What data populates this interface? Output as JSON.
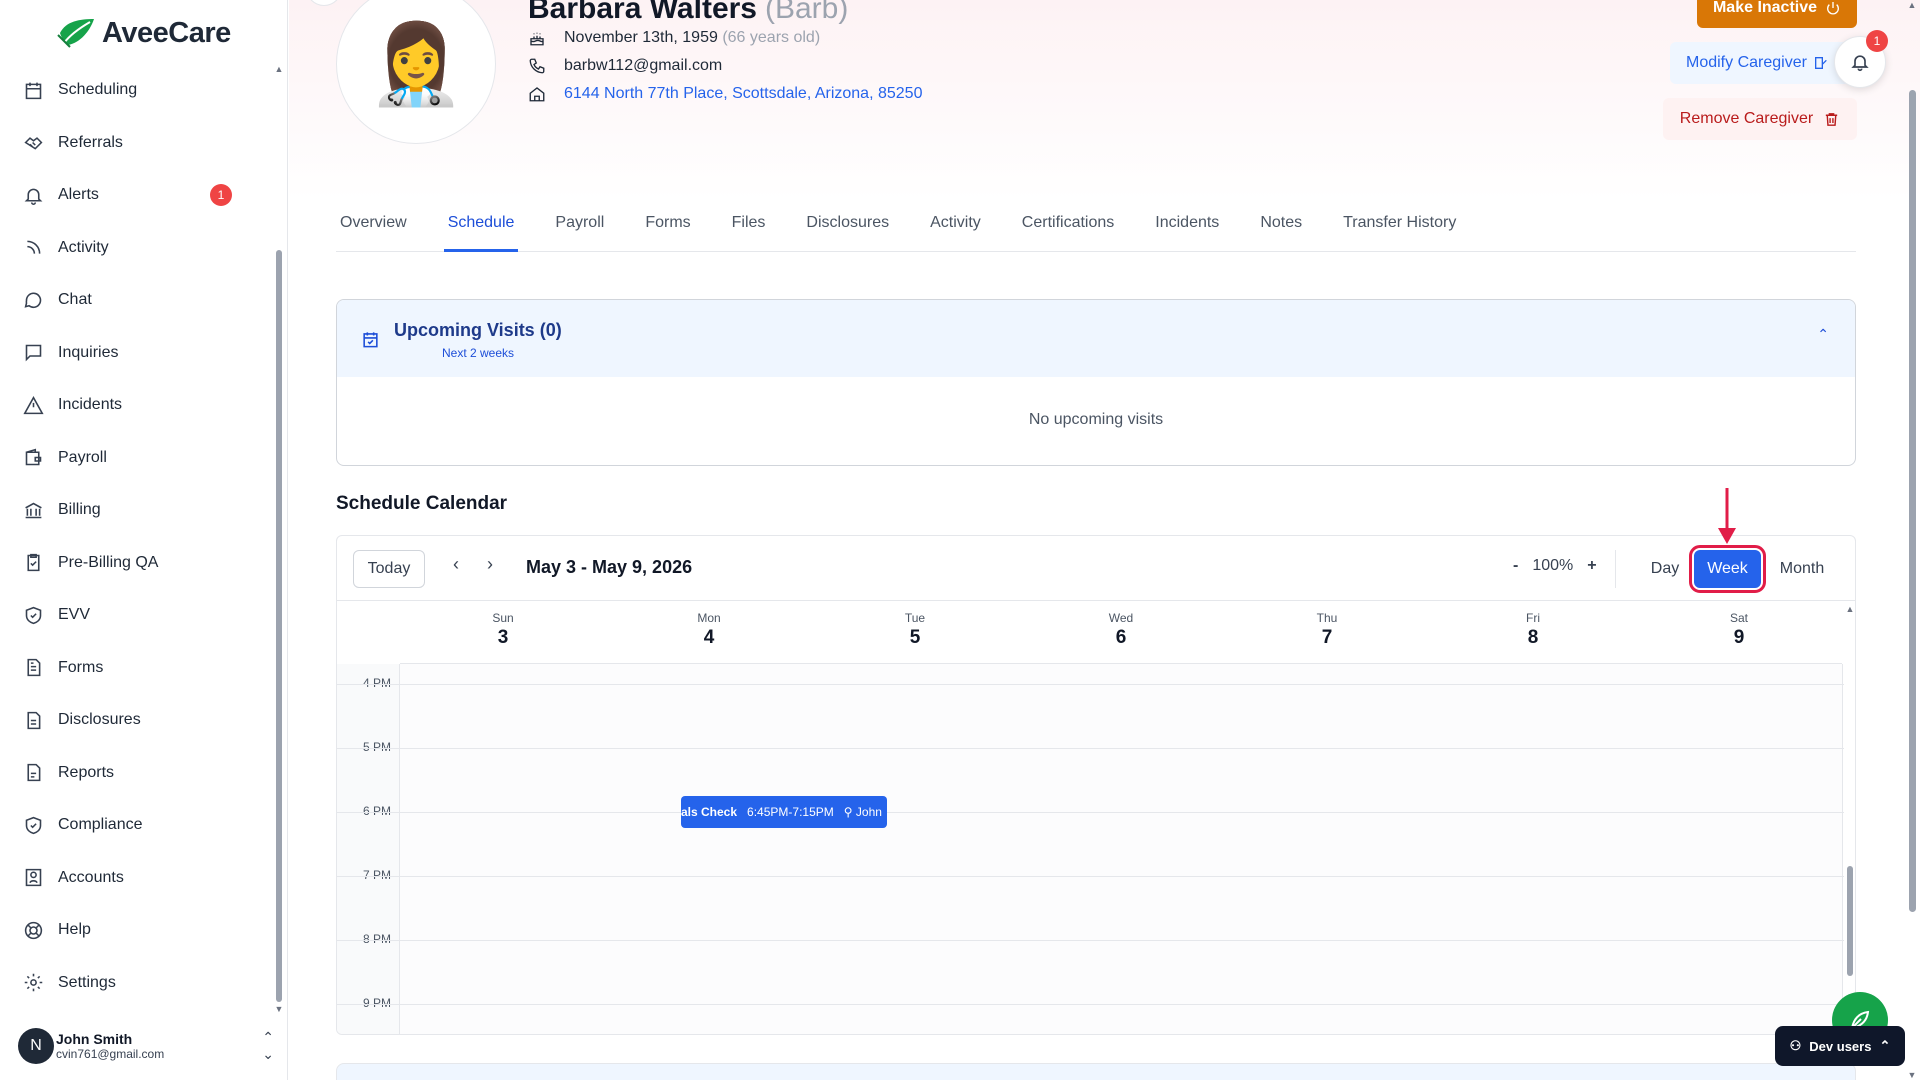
{
  "brand": {
    "name": "AveeCare"
  },
  "sidebar": {
    "items": [
      {
        "label": "Scheduling",
        "icon": "calendar-icon"
      },
      {
        "label": "Referrals",
        "icon": "handshake-icon"
      },
      {
        "label": "Alerts",
        "icon": "bell-icon",
        "badge": "1"
      },
      {
        "label": "Activity",
        "icon": "rss-icon"
      },
      {
        "label": "Chat",
        "icon": "chat-icon"
      },
      {
        "label": "Inquiries",
        "icon": "message-square-icon"
      },
      {
        "label": "Incidents",
        "icon": "warning-triangle-icon"
      },
      {
        "label": "Payroll",
        "icon": "wallet-icon"
      },
      {
        "label": "Billing",
        "icon": "bank-icon"
      },
      {
        "label": "Pre-Billing QA",
        "icon": "clipboard-check-icon"
      },
      {
        "label": "EVV",
        "icon": "shield-check-icon"
      },
      {
        "label": "Forms",
        "icon": "form-icon"
      },
      {
        "label": "Disclosures",
        "icon": "document-icon"
      },
      {
        "label": "Reports",
        "icon": "report-icon"
      },
      {
        "label": "Compliance",
        "icon": "shield-check-icon"
      },
      {
        "label": "Accounts",
        "icon": "contact-icon"
      },
      {
        "label": "Help",
        "icon": "lifebuoy-icon"
      },
      {
        "label": "Settings",
        "icon": "gear-icon"
      }
    ],
    "user": {
      "initial": "N",
      "name": "John Smith",
      "email": "cvin761@gmail.com"
    }
  },
  "profile": {
    "name": "Barbara Walters",
    "nickname": "(Barb)",
    "avatar_emoji": "👩‍⚕️",
    "birthday": "November 13th, 1959",
    "age": "(66 years old)",
    "email": "barbw112@gmail.com",
    "address": "6144 North 77th Place, Scottsdale, Arizona, 85250"
  },
  "actions": {
    "make_inactive": "Make Inactive",
    "modify": "Modify Caregiver",
    "remove": "Remove Caregiver",
    "notifications_count": "1"
  },
  "tabs": [
    {
      "label": "Overview"
    },
    {
      "label": "Schedule",
      "active": true
    },
    {
      "label": "Payroll"
    },
    {
      "label": "Forms"
    },
    {
      "label": "Files"
    },
    {
      "label": "Disclosures"
    },
    {
      "label": "Activity"
    },
    {
      "label": "Certifications"
    },
    {
      "label": "Incidents"
    },
    {
      "label": "Notes"
    },
    {
      "label": "Transfer History"
    }
  ],
  "upcoming": {
    "title": "Upcoming Visits (0)",
    "subtitle": "Next 2 weeks",
    "empty": "No upcoming visits"
  },
  "calendar": {
    "title": "Schedule Calendar",
    "today_label": "Today",
    "range": "May 3 - May 9, 2026",
    "zoom_minus": "-",
    "zoom": "100%",
    "zoom_plus": "+",
    "views": [
      "Day",
      "Week",
      "Month"
    ],
    "active_view": "Week",
    "days": [
      {
        "dow": "Sun",
        "num": "3"
      },
      {
        "dow": "Mon",
        "num": "4"
      },
      {
        "dow": "Tue",
        "num": "5"
      },
      {
        "dow": "Wed",
        "num": "6"
      },
      {
        "dow": "Thu",
        "num": "7"
      },
      {
        "dow": "Fri",
        "num": "8"
      },
      {
        "dow": "Sat",
        "num": "9"
      }
    ],
    "hours": [
      "4 PM",
      "5 PM",
      "6 PM",
      "7 PM",
      "8 PM",
      "9 PM"
    ],
    "event": {
      "title": "als Check",
      "time": "6:45PM-7:15PM",
      "person": "John"
    }
  },
  "dev_users": "Dev users",
  "colors": {
    "primary": "#2563eb",
    "warning": "#d97706",
    "danger": "#b91c1c",
    "highlight": "#e11d48"
  }
}
